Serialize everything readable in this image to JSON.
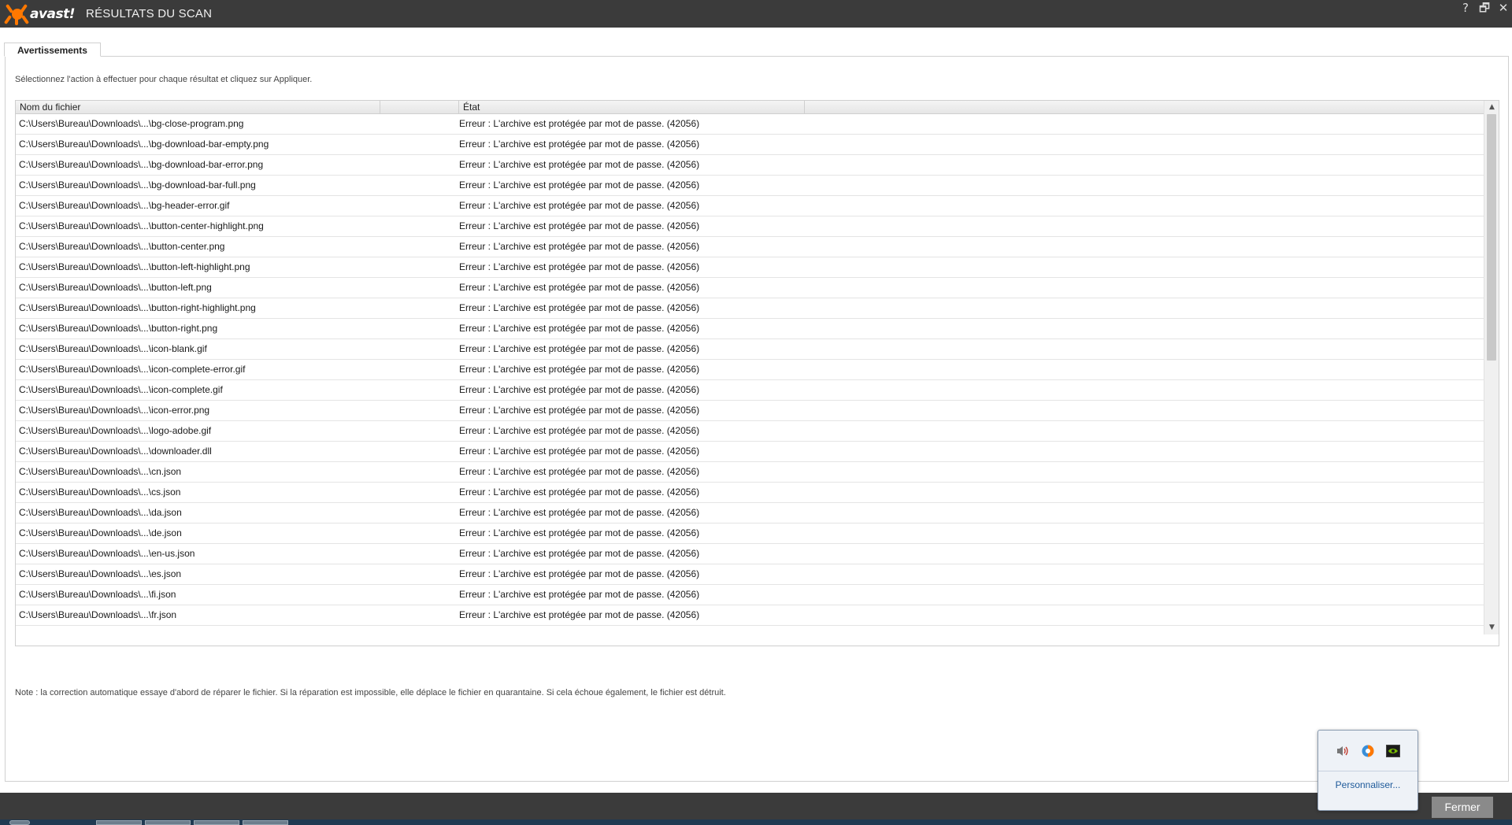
{
  "titlebar": {
    "logo_text": "avast!",
    "title": "RÉSULTATS DU SCAN",
    "help": "?",
    "restore": "🗗",
    "close": "✕"
  },
  "tabs": [
    {
      "label": "Avertissements",
      "active": true
    }
  ],
  "instructions": "Sélectionnez l'action à effectuer pour chaque résultat et cliquez sur Appliquer.",
  "table": {
    "columns": [
      "Nom du fichier",
      "État"
    ],
    "rows": [
      {
        "file": "C:\\Users\\Bureau\\Downloads\\...\\bg-close-program.png",
        "status": "Erreur : L'archive est protégée par mot de passe. (42056)"
      },
      {
        "file": "C:\\Users\\Bureau\\Downloads\\...\\bg-download-bar-empty.png",
        "status": "Erreur : L'archive est protégée par mot de passe. (42056)"
      },
      {
        "file": "C:\\Users\\Bureau\\Downloads\\...\\bg-download-bar-error.png",
        "status": "Erreur : L'archive est protégée par mot de passe. (42056)"
      },
      {
        "file": "C:\\Users\\Bureau\\Downloads\\...\\bg-download-bar-full.png",
        "status": "Erreur : L'archive est protégée par mot de passe. (42056)"
      },
      {
        "file": "C:\\Users\\Bureau\\Downloads\\...\\bg-header-error.gif",
        "status": "Erreur : L'archive est protégée par mot de passe. (42056)"
      },
      {
        "file": "C:\\Users\\Bureau\\Downloads\\...\\button-center-highlight.png",
        "status": "Erreur : L'archive est protégée par mot de passe. (42056)"
      },
      {
        "file": "C:\\Users\\Bureau\\Downloads\\...\\button-center.png",
        "status": "Erreur : L'archive est protégée par mot de passe. (42056)"
      },
      {
        "file": "C:\\Users\\Bureau\\Downloads\\...\\button-left-highlight.png",
        "status": "Erreur : L'archive est protégée par mot de passe. (42056)"
      },
      {
        "file": "C:\\Users\\Bureau\\Downloads\\...\\button-left.png",
        "status": "Erreur : L'archive est protégée par mot de passe. (42056)"
      },
      {
        "file": "C:\\Users\\Bureau\\Downloads\\...\\button-right-highlight.png",
        "status": "Erreur : L'archive est protégée par mot de passe. (42056)"
      },
      {
        "file": "C:\\Users\\Bureau\\Downloads\\...\\button-right.png",
        "status": "Erreur : L'archive est protégée par mot de passe. (42056)"
      },
      {
        "file": "C:\\Users\\Bureau\\Downloads\\...\\icon-blank.gif",
        "status": "Erreur : L'archive est protégée par mot de passe. (42056)"
      },
      {
        "file": "C:\\Users\\Bureau\\Downloads\\...\\icon-complete-error.gif",
        "status": "Erreur : L'archive est protégée par mot de passe. (42056)"
      },
      {
        "file": "C:\\Users\\Bureau\\Downloads\\...\\icon-complete.gif",
        "status": "Erreur : L'archive est protégée par mot de passe. (42056)"
      },
      {
        "file": "C:\\Users\\Bureau\\Downloads\\...\\icon-error.png",
        "status": "Erreur : L'archive est protégée par mot de passe. (42056)"
      },
      {
        "file": "C:\\Users\\Bureau\\Downloads\\...\\logo-adobe.gif",
        "status": "Erreur : L'archive est protégée par mot de passe. (42056)"
      },
      {
        "file": "C:\\Users\\Bureau\\Downloads\\...\\downloader.dll",
        "status": "Erreur : L'archive est protégée par mot de passe. (42056)"
      },
      {
        "file": "C:\\Users\\Bureau\\Downloads\\...\\cn.json",
        "status": "Erreur : L'archive est protégée par mot de passe. (42056)"
      },
      {
        "file": "C:\\Users\\Bureau\\Downloads\\...\\cs.json",
        "status": "Erreur : L'archive est protégée par mot de passe. (42056)"
      },
      {
        "file": "C:\\Users\\Bureau\\Downloads\\...\\da.json",
        "status": "Erreur : L'archive est protégée par mot de passe. (42056)"
      },
      {
        "file": "C:\\Users\\Bureau\\Downloads\\...\\de.json",
        "status": "Erreur : L'archive est protégée par mot de passe. (42056)"
      },
      {
        "file": "C:\\Users\\Bureau\\Downloads\\...\\en-us.json",
        "status": "Erreur : L'archive est protégée par mot de passe. (42056)"
      },
      {
        "file": "C:\\Users\\Bureau\\Downloads\\...\\es.json",
        "status": "Erreur : L'archive est protégée par mot de passe. (42056)"
      },
      {
        "file": "C:\\Users\\Bureau\\Downloads\\...\\fi.json",
        "status": "Erreur : L'archive est protégée par mot de passe. (42056)"
      },
      {
        "file": "C:\\Users\\Bureau\\Downloads\\...\\fr.json",
        "status": "Erreur : L'archive est protégée par mot de passe. (42056)"
      }
    ]
  },
  "note": "Note : la correction automatique essaye d'abord de réparer le fichier. Si la réparation est impossible, elle déplace le fichier en quarantaine. Si cela échoue également, le fichier est détruit.",
  "footer": {
    "close_label": "Fermer"
  },
  "tray_popup": {
    "icons": [
      "speaker-icon",
      "avast-tray-icon",
      "nvidia-icon"
    ],
    "customize_label": "Personnaliser..."
  },
  "colors": {
    "titlebar": "#3b3b3b",
    "brand_orange": "#ff7800",
    "close_button": "#8a8a8a",
    "link_blue": "#1e5a9a"
  }
}
